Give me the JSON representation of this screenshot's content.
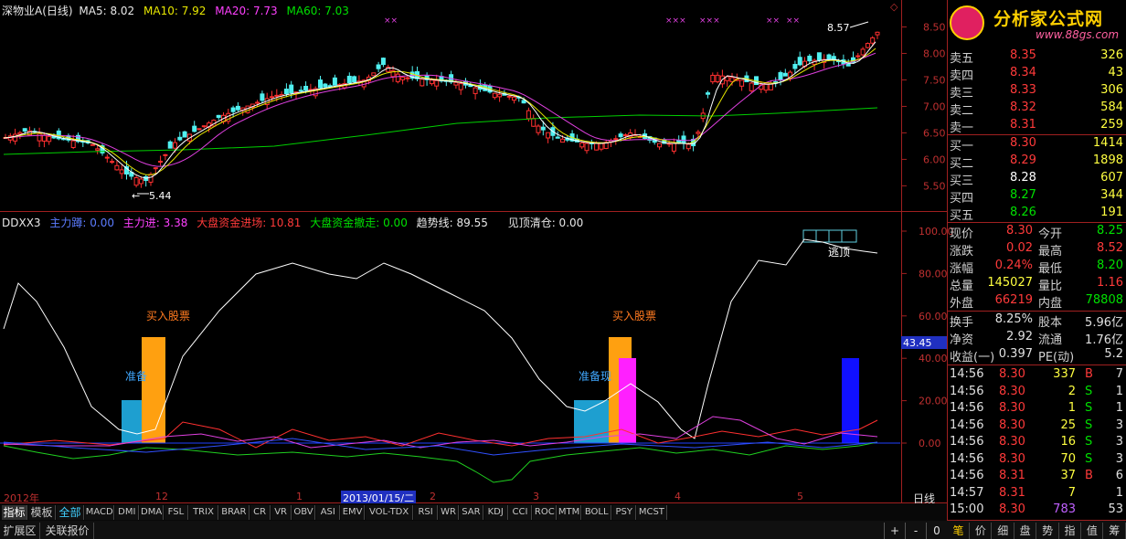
{
  "main": {
    "title": "深物业A(日线)",
    "ma5": "MA5: 8.02",
    "ma10": "MA10: 7.92",
    "ma20": "MA20: 7.73",
    "ma60": "MA60: 7.03",
    "high_mark": "8.57",
    "low_mark": "5.44",
    "price_axis": [
      "8.50",
      "8.00",
      "7.50",
      "7.00",
      "6.50",
      "6.00",
      "5.50"
    ]
  },
  "indicator": {
    "name": "DDXX3",
    "zhulidun": "主力蹲: 0.00",
    "zhulijin": "主力进: 3.38",
    "dapan_in": "大盘资金进场: 10.81",
    "dapan_out": "大盘资金撤走: 0.00",
    "trend": "趋势线: 89.55",
    "top_clear": "见顶清仓: 0.00",
    "buy_label_1": "买入股票",
    "buy_label_2": "买入股票",
    "prep_label_1": "准备",
    "prep_label_2": "准备现",
    "escape_label": "逃顶",
    "current_value": "43.45",
    "axis": [
      "100.00",
      "80.00",
      "60.00",
      "40.00",
      "20.00",
      "0.00"
    ]
  },
  "time_axis": {
    "labels": [
      "2012年",
      "12",
      "1",
      "2013/01/15/二",
      "2",
      "3",
      "4",
      "5"
    ],
    "period": "日线"
  },
  "chart_data": [
    {
      "type": "candlestick",
      "title": "深物业A(日线)",
      "ylim": [
        5.3,
        8.75
      ],
      "series": [
        {
          "name": "MA5",
          "value": 8.02,
          "color": "#ffffff"
        },
        {
          "name": "MA10",
          "value": 7.92,
          "color": "#e8e800"
        },
        {
          "name": "MA20",
          "value": 7.73,
          "color": "#ff40ff"
        },
        {
          "name": "MA60",
          "value": 7.03,
          "color": "#00e000"
        }
      ],
      "annotations": {
        "high": 8.57,
        "low": 5.44
      }
    },
    {
      "type": "line",
      "title": "DDXX3",
      "ylim": [
        -15,
        105
      ],
      "series": [
        {
          "name": "主力进",
          "value": 3.38
        },
        {
          "name": "大盘资金进场",
          "value": 10.81
        },
        {
          "name": "大盘资金撤走",
          "value": 0.0
        },
        {
          "name": "趋势线",
          "value": 89.55
        },
        {
          "name": "见顶清仓",
          "value": 0.0
        }
      ]
    }
  ],
  "quote": {
    "logo_title": "分析家公式网",
    "logo_url": "www.88gs.com",
    "sell": [
      {
        "label": "卖五",
        "price": "8.35",
        "vol": "326"
      },
      {
        "label": "卖四",
        "price": "8.34",
        "vol": "43"
      },
      {
        "label": "卖三",
        "price": "8.33",
        "vol": "306"
      },
      {
        "label": "卖二",
        "price": "8.32",
        "vol": "584"
      },
      {
        "label": "卖一",
        "price": "8.31",
        "vol": "259"
      }
    ],
    "buy": [
      {
        "label": "买一",
        "price": "8.30",
        "vol": "1414"
      },
      {
        "label": "买二",
        "price": "8.29",
        "vol": "1898"
      },
      {
        "label": "买三",
        "price": "8.28",
        "vol": "607"
      },
      {
        "label": "买四",
        "price": "8.27",
        "vol": "344"
      },
      {
        "label": "买五",
        "price": "8.26",
        "vol": "191"
      }
    ],
    "stats": [
      {
        "l1": "现价",
        "v1": "8.30",
        "l2": "今开",
        "v2": "8.25"
      },
      {
        "l1": "涨跌",
        "v1": "0.02",
        "l2": "最高",
        "v2": "8.52"
      },
      {
        "l1": "涨幅",
        "v1": "0.24%",
        "l2": "最低",
        "v2": "8.20"
      },
      {
        "l1": "总量",
        "v1": "145027",
        "l2": "量比",
        "v2": "1.16"
      },
      {
        "l1": "外盘",
        "v1": "66219",
        "l2": "内盘",
        "v2": "78808"
      }
    ],
    "finance": [
      {
        "l1": "换手",
        "v1": "8.25%",
        "l2": "股本",
        "v2": "5.96亿"
      },
      {
        "l1": "净资",
        "v1": "2.92",
        "l2": "流通",
        "v2": "1.76亿"
      },
      {
        "l1": "收益(一)",
        "v1": "0.397",
        "l2": "PE(动)",
        "v2": "5.2"
      }
    ],
    "ticks": [
      {
        "time": "14:56",
        "price": "8.30",
        "vol": "337",
        "side": "B",
        "n": "7"
      },
      {
        "time": "14:56",
        "price": "8.30",
        "vol": "2",
        "side": "S",
        "n": "1"
      },
      {
        "time": "14:56",
        "price": "8.30",
        "vol": "1",
        "side": "S",
        "n": "1"
      },
      {
        "time": "14:56",
        "price": "8.30",
        "vol": "25",
        "side": "S",
        "n": "3"
      },
      {
        "time": "14:56",
        "price": "8.30",
        "vol": "16",
        "side": "S",
        "n": "3"
      },
      {
        "time": "14:56",
        "price": "8.30",
        "vol": "70",
        "side": "S",
        "n": "3"
      },
      {
        "time": "14:56",
        "price": "8.31",
        "vol": "37",
        "side": "B",
        "n": "6"
      },
      {
        "time": "14:57",
        "price": "8.31",
        "vol": "7",
        "side": "",
        "n": "1"
      },
      {
        "time": "15:00",
        "price": "8.30",
        "vol": "783",
        "side": "",
        "n": "53"
      }
    ]
  },
  "tabs": {
    "mode": [
      "指标",
      "模板",
      "全部"
    ],
    "indicators": [
      "MACD",
      "DMI",
      "DMA",
      "FSL",
      "TRIX",
      "BRAR",
      "CR",
      "VR",
      "OBV",
      "ASI",
      "EMV",
      "VOL-TDX",
      "RSI",
      "WR",
      "SAR",
      "KDJ",
      "CCI",
      "ROC",
      "MTM",
      "BOLL",
      "PSY",
      "MCST"
    ],
    "bottom": [
      "扩展区",
      "关联报价"
    ],
    "ctrl": [
      "+",
      "-",
      "0"
    ],
    "right_tabs": [
      "笔",
      "价",
      "细",
      "盘",
      "势",
      "指",
      "值",
      "筹"
    ]
  }
}
